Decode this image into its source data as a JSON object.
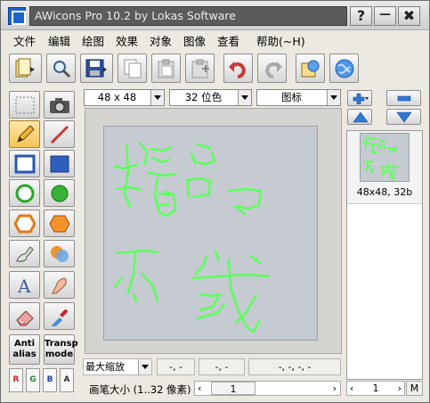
{
  "window": {
    "title": "AWicons Pro 10.2 by Lokas Software",
    "help_button": "?",
    "minimize_button": "—",
    "close_button": "✖"
  },
  "menu": [
    "文件",
    "编辑",
    "绘图",
    "效果",
    "对象",
    "图像",
    "查看",
    "帮助(~H)"
  ],
  "toolbar": {
    "buttons": [
      "open-icon",
      "zoom-icon",
      "save-icon",
      "copy-icon",
      "paste-icon",
      "paste-new-icon",
      "undo-icon",
      "redo-icon",
      "explorer-icon",
      "web-icon"
    ]
  },
  "tools": {
    "buttons": [
      "select-icon",
      "camera-icon",
      "pencil-icon",
      "line-icon",
      "rectangle-icon",
      "filled-rectangle-icon",
      "ellipse-icon",
      "filled-ellipse-icon",
      "hexagon-icon",
      "filled-hexagon-icon",
      "fill-brush-icon",
      "recolor-icon",
      "text-icon",
      "airbrush-icon",
      "eraser-icon",
      "color-picker-icon"
    ],
    "antialias_line1": "Anti",
    "antialias_line2": "alias",
    "transp_line1": "Transp",
    "transp_line2": "mode",
    "channels": [
      "R",
      "G",
      "B",
      "A"
    ]
  },
  "format_bar": {
    "size": "48 x 48",
    "depth": "32 位色",
    "type": "图标"
  },
  "status": {
    "zoom": "最大缩放",
    "coord1": "-, -",
    "coord2": "-, -",
    "coord3": "-, -, -, -",
    "pen_size_label": "画笔大小 (1..32 像素)",
    "pen_size_value": "1"
  },
  "icon_list": {
    "item_label": "48x48, 32b",
    "page_value": "1",
    "page_m": "M"
  },
  "colors": {
    "drawing_stroke": "#5cff5c",
    "canvas_bg": "#c5cbd0"
  }
}
